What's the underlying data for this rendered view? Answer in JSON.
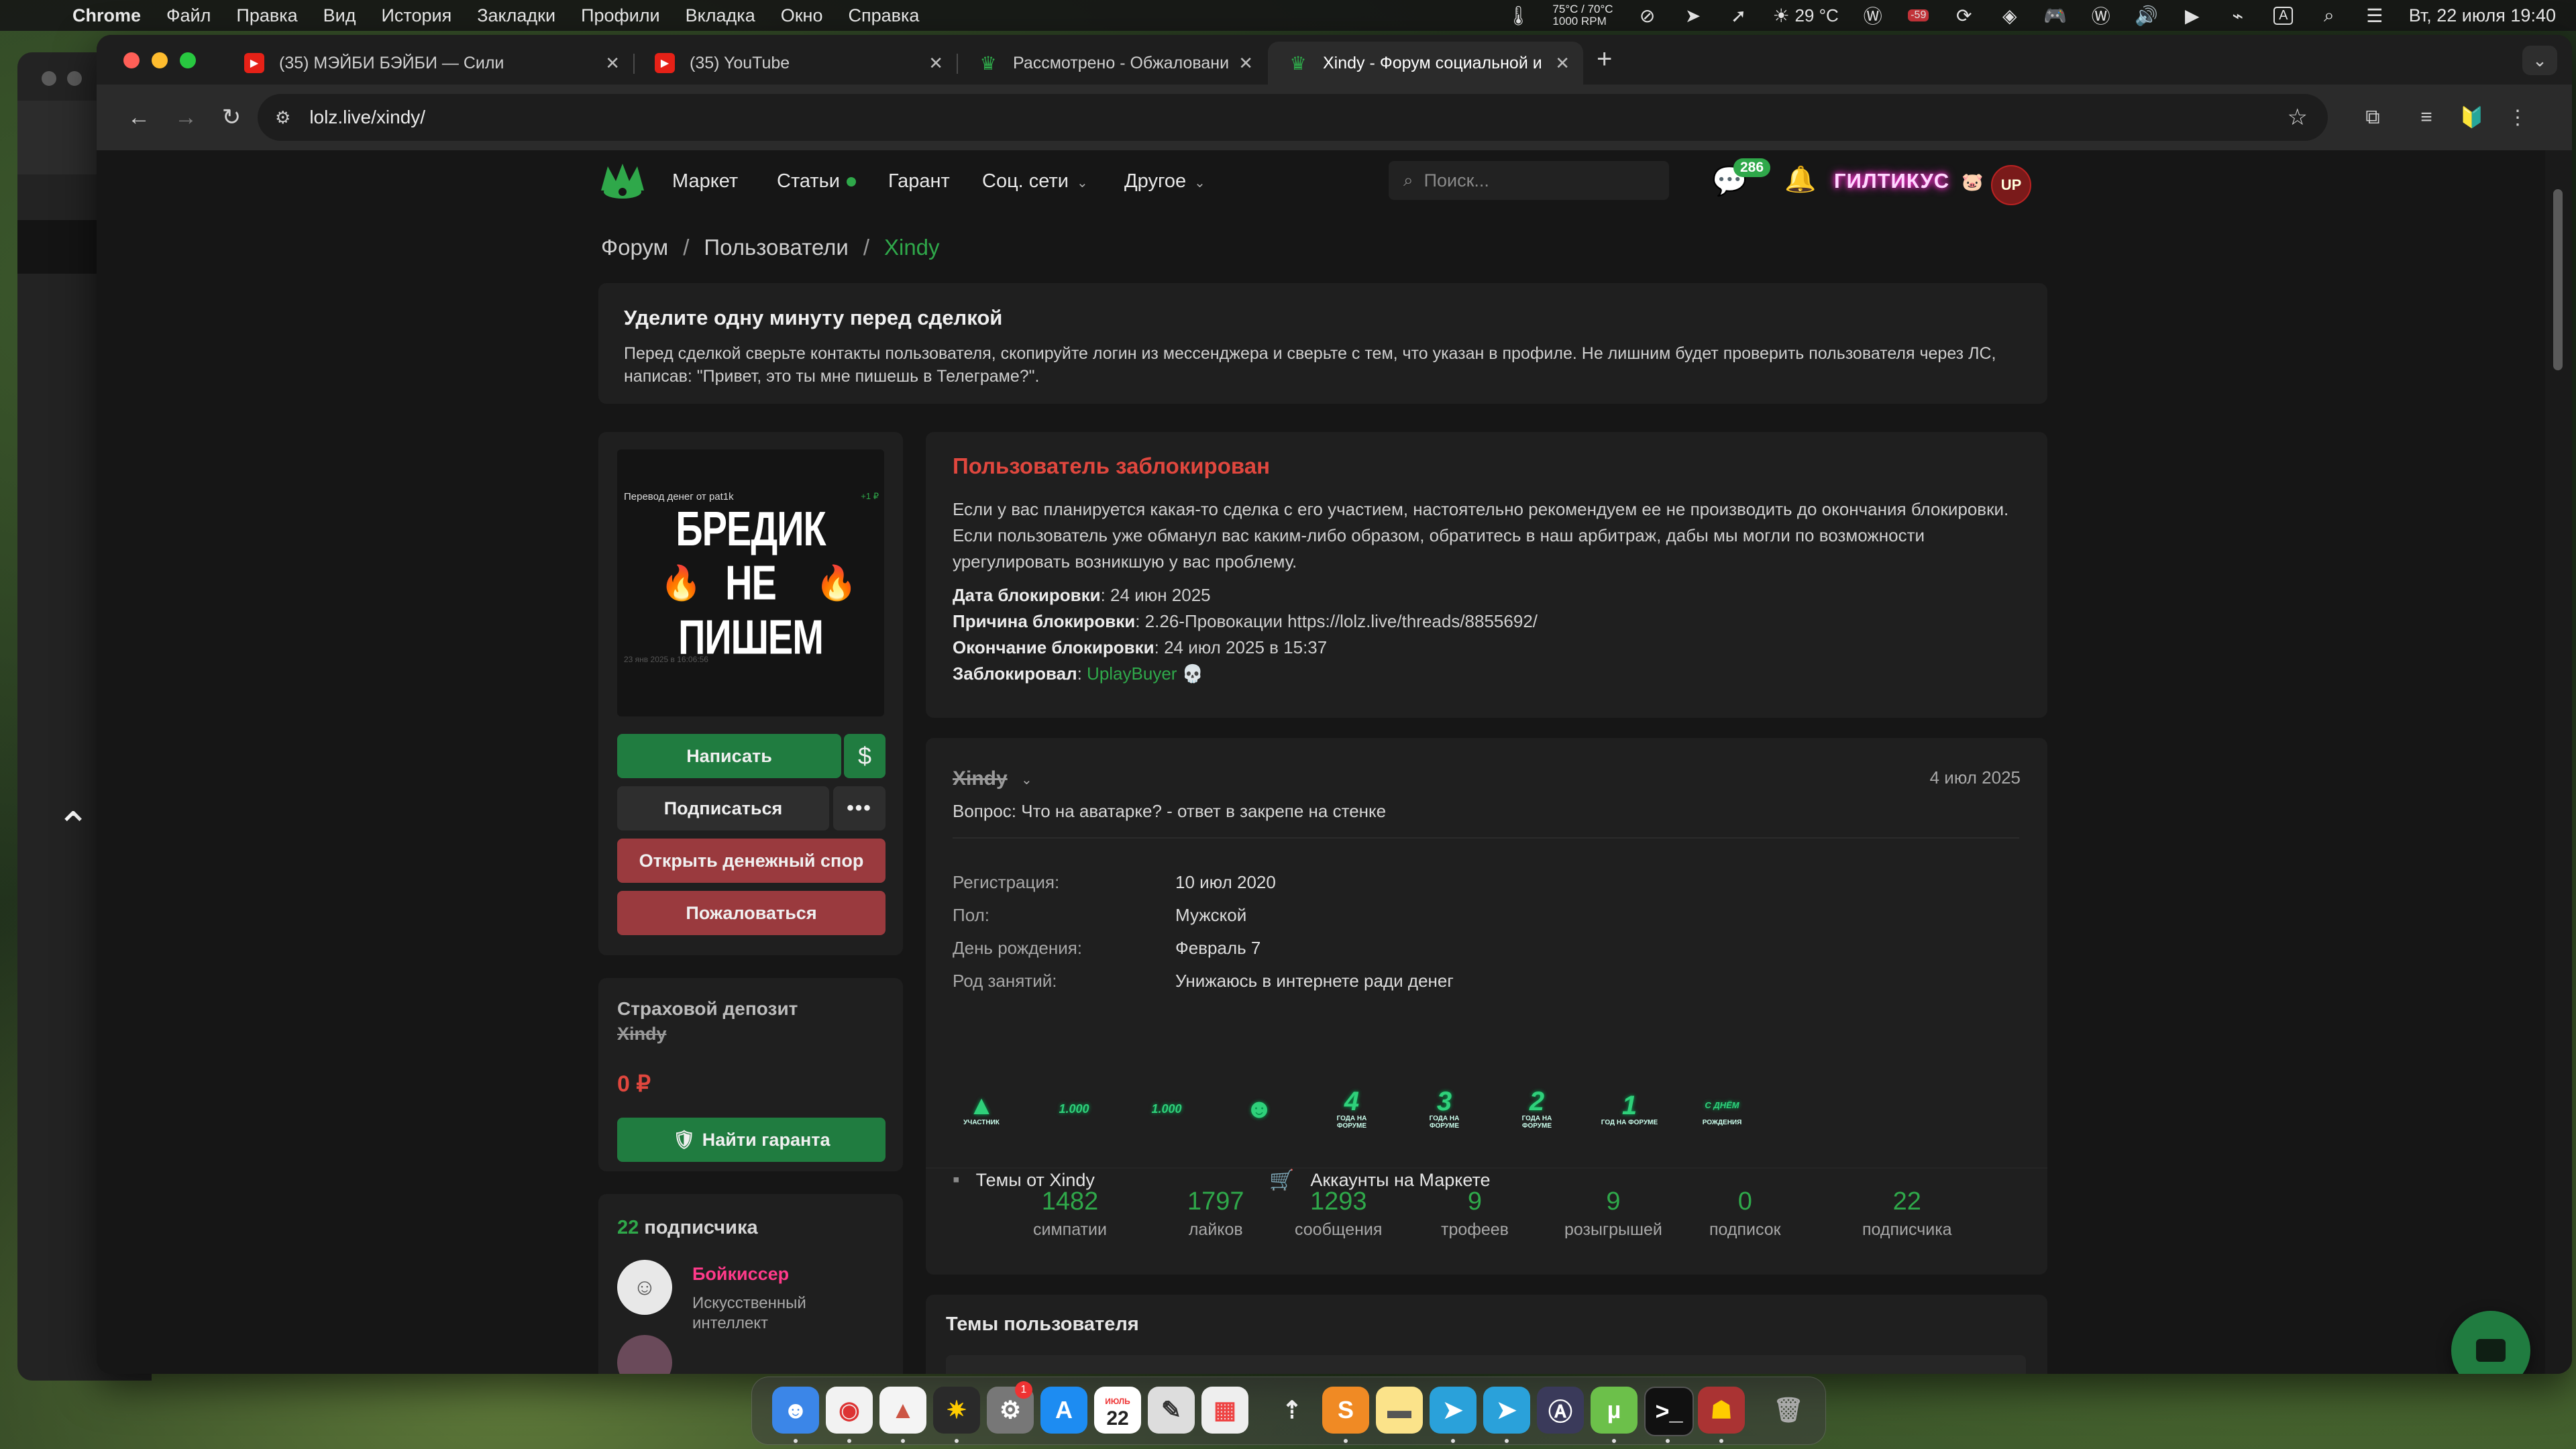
{
  "menubar": {
    "app_name": "Chrome",
    "menus": [
      "Файл",
      "Правка",
      "Вид",
      "История",
      "Закладки",
      "Профили",
      "Вкладка",
      "Окно",
      "Справка"
    ],
    "temp_line1": "75°C / 70°C",
    "temp_line2": "1000 RPM",
    "weather": "29 °C",
    "badge_value": "-59",
    "input_source": "A",
    "datetime": "Вт, 22 июля  19:40"
  },
  "tabs": [
    {
      "title": "(35) МЭЙБИ БЭЙБИ — Сили",
      "favicon": "youtube-icon"
    },
    {
      "title": "(35) YouTube",
      "favicon": "youtube-icon"
    },
    {
      "title": "Рассмотрено - Обжаловани",
      "favicon": "lolz-icon"
    },
    {
      "title": "Xindy - Форум социальной и",
      "favicon": "lolz-icon",
      "active": true
    }
  ],
  "address_bar": {
    "url": "lolz.live/xindy/"
  },
  "site_nav": {
    "links": [
      "Маркет",
      "Статьи",
      "Гарант",
      "Соц. сети",
      "Другое"
    ],
    "search_placeholder": "Поиск...",
    "messages_count": "286",
    "user_nick": "ГИЛТИКУС",
    "avatar_initials": "UP"
  },
  "breadcrumb": [
    "Форум",
    "Пользователи",
    "Xindy"
  ],
  "notice": {
    "title": "Уделите одну минуту перед сделкой",
    "text": "Перед сделкой сверьте контакты пользователя, скопируйте логин из мессенджера и сверьте с тем, что указан в профиле. Не лишним будет проверить пользователя через ЛС, написав: \"Привет, это ты мне пишешь в Телеграме?\"."
  },
  "avatar": {
    "caption": "Перевод денег от pat1k",
    "caption_amount": "+1 ₽",
    "big_text": "БРЕДИК НЕ ПИШЕМ",
    "date": "23 янв 2025 в 16:06:56"
  },
  "actions": {
    "write": "Написать",
    "dollar": "$",
    "subscribe": "Подписаться",
    "more": "•••",
    "dispute": "Открыть денежный спор",
    "report": "Пожаловаться"
  },
  "deposit": {
    "label": "Страховой депозит",
    "nick": "Xindy",
    "amount": "0 ₽",
    "find_guarantor": "Найти гаранта"
  },
  "subscribers": {
    "count": "22",
    "label": "подписчика",
    "first": {
      "name": "Бойкиссер",
      "desc": "Искусственный интеллект"
    }
  },
  "ban": {
    "title": "Пользователь заблокирован",
    "text": "Если у вас планируется какая-то сделка с его участием, настоятельно рекомендуем ее не производить до окончания блокировки. Если пользователь уже обманул вас каким-либо образом, обратитесь в наш арбитраж, дабы мы могли по возможности урегулировать возникшую у вас проблему.",
    "date_label": "Дата блокировки",
    "date_value": ": 24 июн 2025",
    "reason_label": "Причина блокировки",
    "reason_value": ": 2.26-Провокации https://lolz.live/threads/8855692/",
    "end_label": "Окончание блокировки",
    "end_value": ": 24 июл 2025 в 15:37",
    "by_label": "Заблокировал",
    "by_value": "UplayBuyer"
  },
  "profile": {
    "nick": "Xindy",
    "date": "4 июл 2025",
    "status": "Вопрос: Что на аватарке? - ответ в закрепе на стенке",
    "fields": [
      {
        "label": "Регистрация:",
        "value": "10 июл 2020"
      },
      {
        "label": "Пол:",
        "value": "Мужской"
      },
      {
        "label": "День рождения:",
        "value": "Февраль 7"
      },
      {
        "label": "Род занятий:",
        "value": "Унижаюсь в интернете ради денег"
      }
    ],
    "links": [
      "Темы от Xindy",
      "Аккаунты на Маркете"
    ],
    "trophies": [
      {
        "main": "▲",
        "sub": "УЧАСТНИК"
      },
      {
        "main": "1.000",
        "sub": ""
      },
      {
        "main": "1.000",
        "sub": ""
      },
      {
        "main": "☻",
        "sub": ""
      },
      {
        "main": "4",
        "sub": "ГОДА НА ФОРУМЕ"
      },
      {
        "main": "3",
        "sub": "ГОДА НА ФОРУМЕ"
      },
      {
        "main": "2",
        "sub": "ГОДА НА ФОРУМЕ"
      },
      {
        "main": "1",
        "sub": "ГОД НА ФОРУМЕ"
      },
      {
        "main": "С ДНЁМ",
        "sub": "РОЖДЕНИЯ"
      }
    ],
    "stats": [
      {
        "value": "1482",
        "label": "симпатии"
      },
      {
        "value": "1797",
        "label": "лайков"
      },
      {
        "value": "1293",
        "label": "сообщения"
      },
      {
        "value": "9",
        "label": "трофеев"
      },
      {
        "value": "9",
        "label": "розыгрышей"
      },
      {
        "value": "0",
        "label": "подписок"
      },
      {
        "value": "22",
        "label": "подписчика"
      }
    ]
  },
  "topics": {
    "title": "Темы пользователя"
  },
  "dock": {
    "calendar_month": "ИЮЛЬ",
    "calendar_day": "22",
    "badge": "1"
  }
}
